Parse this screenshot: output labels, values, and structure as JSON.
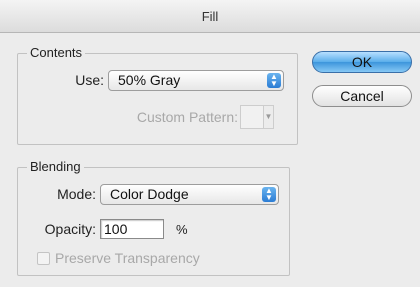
{
  "dialog": {
    "title": "Fill"
  },
  "contents": {
    "group_label": "Contents",
    "use_label": "Use:",
    "use_value": "50% Gray",
    "custom_pattern_label": "Custom Pattern:"
  },
  "blending": {
    "group_label": "Blending",
    "mode_label": "Mode:",
    "mode_value": "Color Dodge",
    "opacity_label": "Opacity:",
    "opacity_value": "100",
    "opacity_unit": "%",
    "preserve_transparency_label": "Preserve Transparency",
    "preserve_transparency_checked": false
  },
  "buttons": {
    "ok_label": "OK",
    "cancel_label": "Cancel"
  },
  "icons": {
    "stepper": "up-down-arrows-icon",
    "pattern_arrow": "triangle-down-icon"
  },
  "colors": {
    "background": "#b8dff2",
    "dialog": "#ececec",
    "accent": "#3d95dc"
  }
}
